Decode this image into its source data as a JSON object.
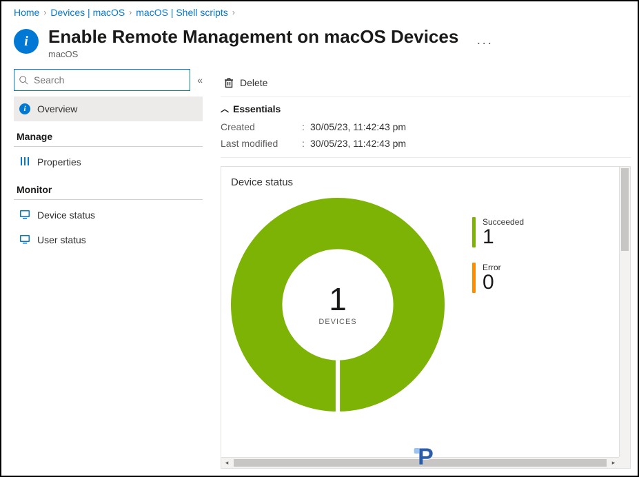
{
  "breadcrumb": [
    {
      "label": "Home"
    },
    {
      "label": "Devices | macOS"
    },
    {
      "label": "macOS | Shell scripts"
    }
  ],
  "header": {
    "title": "Enable Remote Management on macOS Devices",
    "subtitle": "macOS",
    "more": "···"
  },
  "search": {
    "placeholder": "Search",
    "collapse_glyph": "«"
  },
  "sidebar": {
    "overview": "Overview",
    "group_manage": "Manage",
    "properties": "Properties",
    "group_monitor": "Monitor",
    "device_status": "Device status",
    "user_status": "User status"
  },
  "toolbar": {
    "delete": "Delete"
  },
  "essentials": {
    "heading": "Essentials",
    "rows": [
      {
        "label": "Created",
        "value": "30/05/23, 11:42:43 pm"
      },
      {
        "label": "Last modified",
        "value": "30/05/23, 11:42:43 pm"
      }
    ]
  },
  "card": {
    "title": "Device status",
    "center_value": "1",
    "center_label": "DEVICES",
    "legend": {
      "succeeded_label": "Succeeded",
      "succeeded_value": "1",
      "error_label": "Error",
      "error_value": "0"
    }
  },
  "chart_data": {
    "type": "pie",
    "title": "Device status",
    "total_label": "DEVICES",
    "total": 1,
    "series": [
      {
        "name": "Succeeded",
        "value": 1,
        "color": "#7cb305"
      },
      {
        "name": "Error",
        "value": 0,
        "color": "#ff8c00"
      }
    ]
  }
}
